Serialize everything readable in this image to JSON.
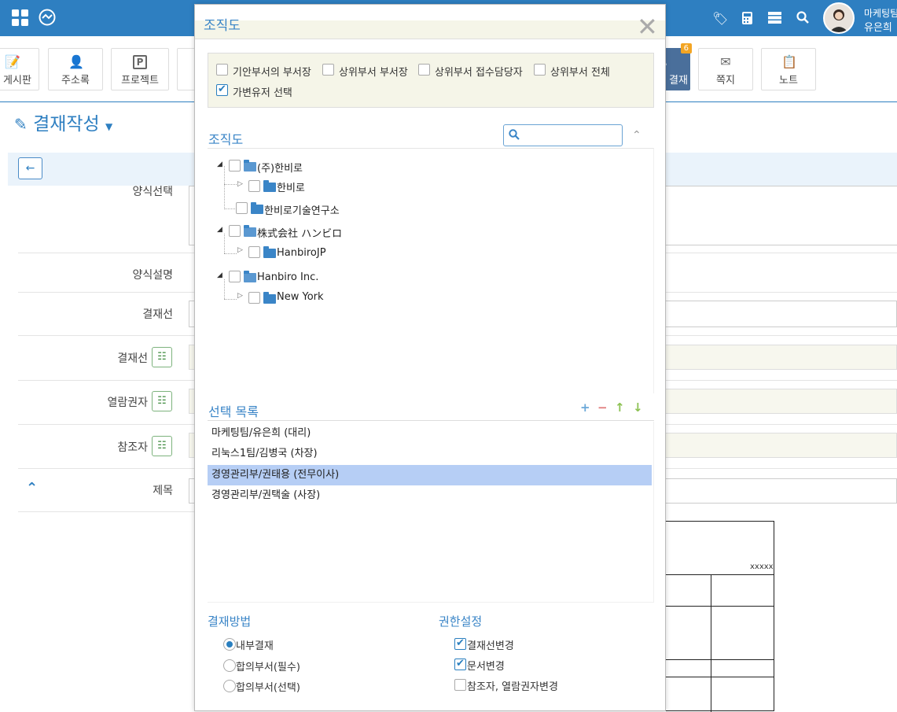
{
  "user": {
    "team": "마케팅팀",
    "name": "유은희"
  },
  "toolbar": {
    "items": [
      {
        "label": "게시판"
      },
      {
        "label": "주소록"
      },
      {
        "label": "프로젝트"
      },
      {
        "label": "결재",
        "badge": "6"
      },
      {
        "label": "쪽지"
      },
      {
        "label": "노트"
      }
    ]
  },
  "page": {
    "title": "결재작성"
  },
  "form": {
    "labels": {
      "form_select": "양식선택",
      "form_desc": "양식설명",
      "approval_line_select": "결재선",
      "approval_line": "결재선",
      "viewer": "열람권자",
      "reference": "참조자",
      "subject": "제목"
    },
    "doc_placeholder": "xxxxx"
  },
  "modal": {
    "title": "조직도",
    "options": [
      {
        "label": "기안부서의 부서장",
        "checked": false
      },
      {
        "label": "상위부서 부서장",
        "checked": false
      },
      {
        "label": "상위부서 접수담당자",
        "checked": false
      },
      {
        "label": "상위부서 전체",
        "checked": false
      },
      {
        "label": "가변유저 선택",
        "checked": true
      }
    ],
    "org_title": "조직도",
    "search_placeholder": "",
    "tree": [
      {
        "label": "(주)한비로",
        "children": [
          "한비로",
          "한비로기술연구소"
        ]
      },
      {
        "label": "株式会社 ハンビロ",
        "children": [
          "HanbiroJP"
        ]
      },
      {
        "label": "Hanbiro Inc.",
        "children": [
          "New York"
        ]
      }
    ],
    "selected_title": "선택 목록",
    "selected": [
      {
        "label": "마케팅팀/유은희 (대리)"
      },
      {
        "label": "리눅스1팀/김병국 (차장)"
      },
      {
        "label": "경영관리부/권태용 (전무이사)",
        "highlighted": true
      },
      {
        "label": "경영관리부/권택술 (사장)"
      }
    ],
    "method_title": "결재방법",
    "methods": [
      {
        "label": "내부결재",
        "checked": true
      },
      {
        "label": "합의부서(필수)",
        "checked": false
      },
      {
        "label": "합의부서(선택)",
        "checked": false
      }
    ],
    "perm_title": "권한설정",
    "perms": [
      {
        "label": "결재선변경",
        "checked": true
      },
      {
        "label": "문서변경",
        "checked": true
      },
      {
        "label": "참조자, 열람권자변경",
        "checked": false
      }
    ]
  },
  "colors": {
    "primary": "#2e7fc1",
    "highlight": "#b6cef5",
    "badge": "#f3a523"
  }
}
